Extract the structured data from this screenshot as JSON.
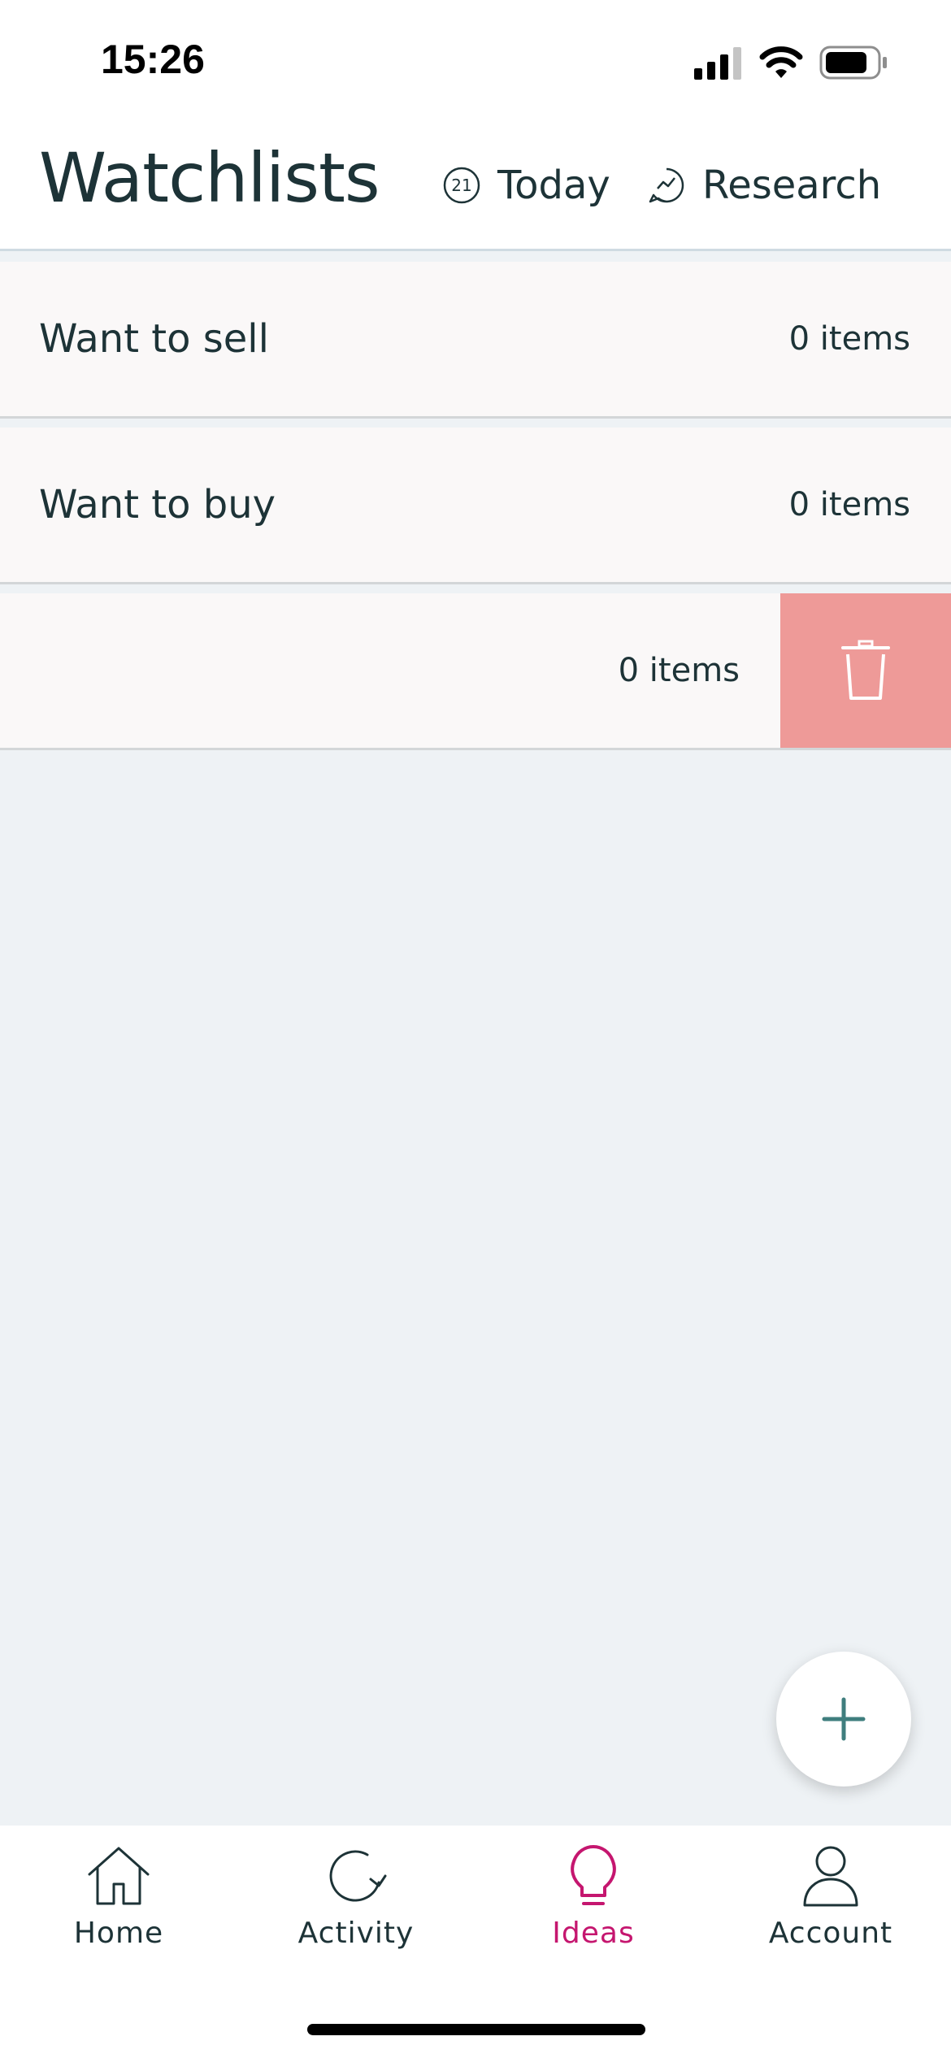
{
  "status_bar": {
    "time": "15:26",
    "icons": [
      "signal-icon",
      "wifi-icon",
      "battery-icon"
    ]
  },
  "header": {
    "title": "Watchlists",
    "today_badge": "21",
    "today_label": "Today",
    "research_label": "Research"
  },
  "watchlists": [
    {
      "name": "Want to sell",
      "count": "0 items"
    },
    {
      "name": "Want to buy",
      "count": "0 items"
    },
    {
      "name": "",
      "count": "0 items"
    }
  ],
  "row_actions": {
    "delete_icon": "trash-icon"
  },
  "fab": {
    "icon": "plus-icon"
  },
  "nav": {
    "items": [
      {
        "label": "Home",
        "icon": "home-icon"
      },
      {
        "label": "Activity",
        "icon": "activity-icon"
      },
      {
        "label": "Ideas",
        "icon": "lightbulb-icon",
        "active": true
      },
      {
        "label": "Account",
        "icon": "account-icon"
      }
    ]
  },
  "colors": {
    "text": "#1d3337",
    "accent_active": "#c5166f",
    "delete": "#ee9a98",
    "background": "#eef2f5",
    "teal": "#3f7e7e"
  }
}
